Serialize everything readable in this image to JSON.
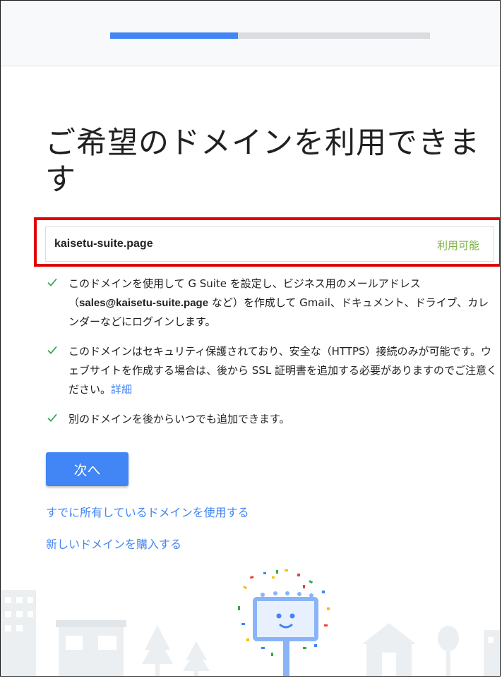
{
  "progress": {
    "fraction": 0.4
  },
  "page": {
    "title_line1": "ご希望のドメインを利用できま",
    "title_line2": "す"
  },
  "domain": {
    "name": "kaisetu-suite.page",
    "status": "利用可能",
    "status_color": "#7cb342"
  },
  "features": [
    {
      "before": "このドメインを使用して G Suite を設定し、ビジネス用のメールアドレス（",
      "email": "sales@kaisetu-suite.page",
      "after": " など）を作成して Gmail、ドキュメント、ドライブ、カレンダーなどにログインします。"
    },
    {
      "text": "このドメインはセキュリティ保護されており、安全な（HTTPS）接続のみが可能です。ウェブサイトを作成する場合は、後から SSL 証明書を追加する必要がありますのでご注意ください。",
      "link": "詳細"
    },
    {
      "text": "別のドメインを後からいつでも追加できます。"
    }
  ],
  "actions": {
    "next_label": "次へ",
    "use_owned_domain": "すでに所有しているドメインを使用する",
    "buy_new_domain": "新しいドメインを購入する"
  },
  "colors": {
    "accent": "#4285f4",
    "check": "#34a853",
    "highlight_border": "#e00000",
    "progress_track": "#dadce0"
  }
}
